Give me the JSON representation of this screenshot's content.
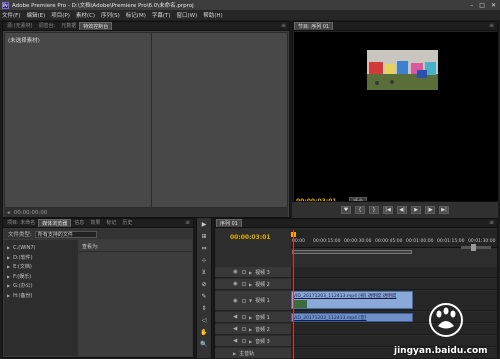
{
  "window": {
    "title": "Adobe Premiere Pro - D:\\文档\\Adobe\\Premiere Pro\\6.0\\未命名.prproj",
    "controls": [
      "–",
      "□",
      "✕"
    ]
  },
  "menu": [
    "文件(F)",
    "编辑(E)",
    "项目(P)",
    "素材(C)",
    "序列(S)",
    "标记(M)",
    "字幕(T)",
    "窗口(W)",
    "帮助(H)"
  ],
  "source_panel": {
    "tabs": [
      "源:(无素材)",
      "调音台:",
      "元数据",
      "特效控制台"
    ],
    "active_tab": 3,
    "empty_label": "(未选择素材)",
    "footer_tc": "00:00:00:00"
  },
  "program_panel": {
    "tab": "节目: 序列 01",
    "timecode": "00:00:03:01",
    "fit": "适合"
  },
  "transport": [
    "♥",
    "{",
    "}",
    "|◀",
    "◀|",
    "▶",
    "|▶",
    "▶|"
  ],
  "project_panel": {
    "tabs": [
      "项目: 未命名",
      "媒体浏览器",
      "信息",
      "效果",
      "标记",
      "历史"
    ],
    "active_tab": 1,
    "filetype_label": "文件类型:",
    "filetype_value": "所有支持的文件",
    "view_label": "查看为:",
    "drives": [
      "C:(WIN7)",
      "D:(软件)",
      "E:(文档)",
      "F:(娱乐)",
      "G:(办公)",
      "H:(备份)"
    ]
  },
  "tools": [
    "▶",
    "⊞",
    "⇔",
    "⊹",
    "⊻",
    "⊘",
    "✎",
    "⇕",
    "◁",
    "✋",
    "🔍"
  ],
  "timeline": {
    "tab": "序列 01",
    "timecode": "00:00:03:01",
    "ruler": [
      "00:00",
      "00:00:15:00",
      "00:00:30:00",
      "00:00:45:00",
      "00:01:00:00",
      "00:01:15:00",
      "00:01:30:00"
    ],
    "tracks": [
      {
        "name": "视频 3",
        "kind": "video"
      },
      {
        "name": "视频 2",
        "kind": "video"
      },
      {
        "name": "视频 1",
        "kind": "video"
      },
      {
        "name": "音频 1",
        "kind": "audio"
      },
      {
        "name": "音频 2",
        "kind": "audio"
      },
      {
        "name": "音频 3",
        "kind": "audio"
      },
      {
        "name": "主音轨",
        "kind": "audio"
      }
    ],
    "video_clip": "VID_20171203_112413.mp4 [视] 透明度:透明度",
    "audio_clip": "VID_20171203_112413.mp4 [音]"
  },
  "watermark": "jingyan.baidu.com"
}
